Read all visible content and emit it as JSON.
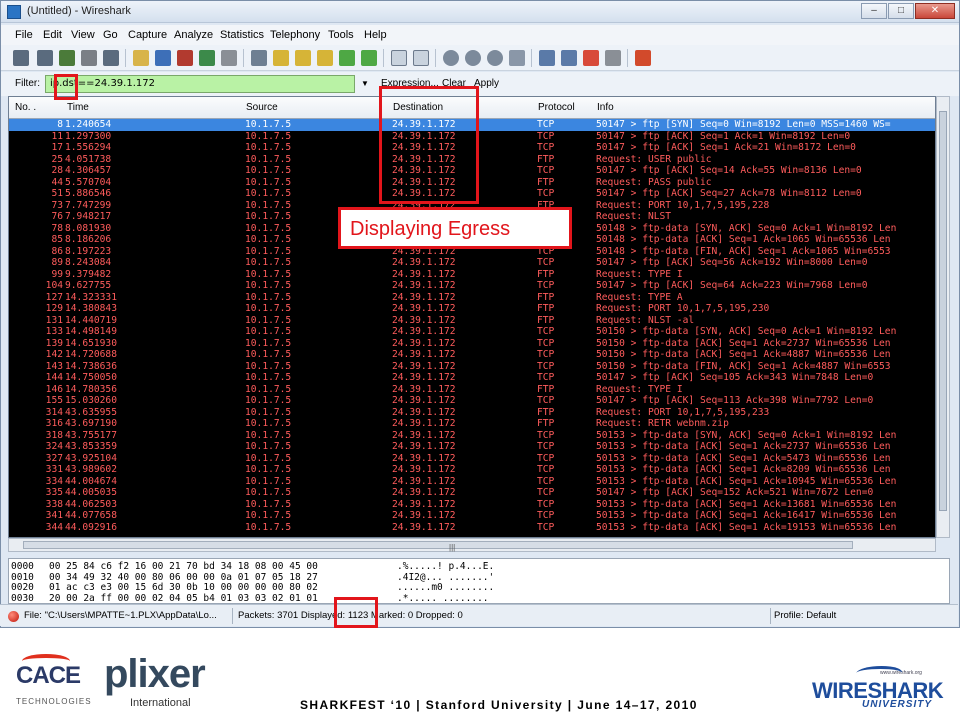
{
  "window": {
    "title": "(Untitled) - Wireshark",
    "controls": [
      "minimize",
      "maximize",
      "close"
    ]
  },
  "menu": [
    "File",
    "Edit",
    "View",
    "Go",
    "Capture",
    "Analyze",
    "Statistics",
    "Telephony",
    "Tools",
    "Help"
  ],
  "toolbar_icons": [
    "interface-list-icon",
    "capture-options-icon",
    "start-capture-icon",
    "stop-capture-icon",
    "restart-capture-icon",
    "open-file-icon",
    "save-file-icon",
    "close-file-icon",
    "reload-icon",
    "print-icon",
    "find-packet-icon",
    "go-back-icon",
    "go-forward-icon",
    "go-to-packet-icon",
    "go-first-icon",
    "go-last-icon",
    "colorize-icon",
    "autoscroll-icon",
    "zoom-in-icon",
    "zoom-out-icon",
    "normal-size-icon",
    "resize-columns-icon",
    "capture-filters-icon",
    "display-filters-icon",
    "coloring-rules-icon",
    "preferences-icon",
    "help-icon"
  ],
  "filter": {
    "label": "Filter:",
    "value": "ip.dst==24.39.1.172",
    "expression": "Expression...",
    "clear": "Clear",
    "apply": "Apply"
  },
  "packet_list": {
    "columns": [
      "No. .",
      "Time",
      "Source",
      "Destination",
      "Protocol",
      "Info"
    ],
    "rows": [
      {
        "no": "8",
        "time": "1.240654",
        "src": "10.1.7.5",
        "dst": "24.39.1.172",
        "proto": "TCP",
        "info": "50147 > ftp [SYN] Seq=0 Win=8192 Len=0 MSS=1460 WS=",
        "selected": true
      },
      {
        "no": "11",
        "time": "1.297300",
        "src": "10.1.7.5",
        "dst": "24.39.1.172",
        "proto": "TCP",
        "info": "50147 > ftp [ACK] Seq=1 Ack=1 Win=8192 Len=0"
      },
      {
        "no": "17",
        "time": "1.556294",
        "src": "10.1.7.5",
        "dst": "24.39.1.172",
        "proto": "TCP",
        "info": "50147 > ftp [ACK] Seq=1 Ack=21 Win=8172 Len=0"
      },
      {
        "no": "25",
        "time": "4.051738",
        "src": "10.1.7.5",
        "dst": "24.39.1.172",
        "proto": "FTP",
        "info": "Request: USER public"
      },
      {
        "no": "28",
        "time": "4.306457",
        "src": "10.1.7.5",
        "dst": "24.39.1.172",
        "proto": "TCP",
        "info": "50147 > ftp [ACK] Seq=14 Ack=55 Win=8136 Len=0"
      },
      {
        "no": "44",
        "time": "5.570704",
        "src": "10.1.7.5",
        "dst": "24.39.1.172",
        "proto": "FTP",
        "info": "Request: PASS public"
      },
      {
        "no": "51",
        "time": "5.886546",
        "src": "10.1.7.5",
        "dst": "24.39.1.172",
        "proto": "TCP",
        "info": "50147 > ftp [ACK] Seq=27 Ack=78 Win=8112 Len=0"
      },
      {
        "no": "73",
        "time": "7.747299",
        "src": "10.1.7.5",
        "dst": "24.39.1.172",
        "proto": "FTP",
        "info": "Request: PORT 10,1,7,5,195,228"
      },
      {
        "no": "76",
        "time": "7.948217",
        "src": "10.1.7.5",
        "dst": "24.39.1.172",
        "proto": "FTP",
        "info": "Request: NLST"
      },
      {
        "no": "78",
        "time": "8.081930",
        "src": "10.1.7.5",
        "dst": "24.39.1.172",
        "proto": "TCP",
        "info": "50148 > ftp-data [SYN, ACK] Seq=0 Ack=1 Win=8192 Len"
      },
      {
        "no": "85",
        "time": "8.186206",
        "src": "10.1.7.5",
        "dst": "24.39.1.172",
        "proto": "TCP",
        "info": "50148 > ftp-data [ACK] Seq=1 Ack=1065 Win=65536 Len"
      },
      {
        "no": "86",
        "time": "8.197223",
        "src": "10.1.7.5",
        "dst": "24.39.1.172",
        "proto": "TCP",
        "info": "50148 > ftp-data [FIN, ACK] Seq=1 Ack=1065 Win=6553"
      },
      {
        "no": "89",
        "time": "8.243084",
        "src": "10.1.7.5",
        "dst": "24.39.1.172",
        "proto": "TCP",
        "info": "50147 > ftp [ACK] Seq=56 Ack=192 Win=8000 Len=0"
      },
      {
        "no": "99",
        "time": "9.379482",
        "src": "10.1.7.5",
        "dst": "24.39.1.172",
        "proto": "FTP",
        "info": "Request: TYPE I"
      },
      {
        "no": "104",
        "time": "9.627755",
        "src": "10.1.7.5",
        "dst": "24.39.1.172",
        "proto": "TCP",
        "info": "50147 > ftp [ACK] Seq=64 Ack=223 Win=7968 Len=0"
      },
      {
        "no": "127",
        "time": "14.323331",
        "src": "10.1.7.5",
        "dst": "24.39.1.172",
        "proto": "FTP",
        "info": "Request: TYPE A"
      },
      {
        "no": "129",
        "time": "14.380843",
        "src": "10.1.7.5",
        "dst": "24.39.1.172",
        "proto": "FTP",
        "info": "Request: PORT 10,1,7,5,195,230"
      },
      {
        "no": "131",
        "time": "14.440719",
        "src": "10.1.7.5",
        "dst": "24.39.1.172",
        "proto": "FTP",
        "info": "Request: NLST -al"
      },
      {
        "no": "133",
        "time": "14.498149",
        "src": "10.1.7.5",
        "dst": "24.39.1.172",
        "proto": "TCP",
        "info": "50150 > ftp-data [SYN, ACK] Seq=0 Ack=1 Win=8192 Len"
      },
      {
        "no": "139",
        "time": "14.651930",
        "src": "10.1.7.5",
        "dst": "24.39.1.172",
        "proto": "TCP",
        "info": "50150 > ftp-data [ACK] Seq=1 Ack=2737 Win=65536 Len"
      },
      {
        "no": "142",
        "time": "14.720688",
        "src": "10.1.7.5",
        "dst": "24.39.1.172",
        "proto": "TCP",
        "info": "50150 > ftp-data [ACK] Seq=1 Ack=4887 Win=65536 Len"
      },
      {
        "no": "143",
        "time": "14.738636",
        "src": "10.1.7.5",
        "dst": "24.39.1.172",
        "proto": "TCP",
        "info": "50150 > ftp-data [FIN, ACK] Seq=1 Ack=4887 Win=6553"
      },
      {
        "no": "144",
        "time": "14.750050",
        "src": "10.1.7.5",
        "dst": "24.39.1.172",
        "proto": "TCP",
        "info": "50147 > ftp [ACK] Seq=105 Ack=343 Win=7848 Len=0"
      },
      {
        "no": "146",
        "time": "14.780356",
        "src": "10.1.7.5",
        "dst": "24.39.1.172",
        "proto": "FTP",
        "info": "Request: TYPE I"
      },
      {
        "no": "155",
        "time": "15.030260",
        "src": "10.1.7.5",
        "dst": "24.39.1.172",
        "proto": "TCP",
        "info": "50147 > ftp [ACK] Seq=113 Ack=398 Win=7792 Len=0"
      },
      {
        "no": "314",
        "time": "43.635955",
        "src": "10.1.7.5",
        "dst": "24.39.1.172",
        "proto": "FTP",
        "info": "Request: PORT 10,1,7,5,195,233"
      },
      {
        "no": "316",
        "time": "43.697190",
        "src": "10.1.7.5",
        "dst": "24.39.1.172",
        "proto": "FTP",
        "info": "Request: RETR webnm.zip"
      },
      {
        "no": "318",
        "time": "43.755177",
        "src": "10.1.7.5",
        "dst": "24.39.1.172",
        "proto": "TCP",
        "info": "50153 > ftp-data [SYN, ACK] Seq=0 Ack=1 Win=8192 Len"
      },
      {
        "no": "324",
        "time": "43.853359",
        "src": "10.1.7.5",
        "dst": "24.39.1.172",
        "proto": "TCP",
        "info": "50153 > ftp-data [ACK] Seq=1 Ack=2737 Win=65536 Len"
      },
      {
        "no": "327",
        "time": "43.925104",
        "src": "10.1.7.5",
        "dst": "24.39.1.172",
        "proto": "TCP",
        "info": "50153 > ftp-data [ACK] Seq=1 Ack=5473 Win=65536 Len"
      },
      {
        "no": "331",
        "time": "43.989602",
        "src": "10.1.7.5",
        "dst": "24.39.1.172",
        "proto": "TCP",
        "info": "50153 > ftp-data [ACK] Seq=1 Ack=8209 Win=65536 Len"
      },
      {
        "no": "334",
        "time": "44.004674",
        "src": "10.1.7.5",
        "dst": "24.39.1.172",
        "proto": "TCP",
        "info": "50153 > ftp-data [ACK] Seq=1 Ack=10945 Win=65536 Len"
      },
      {
        "no": "335",
        "time": "44.005035",
        "src": "10.1.7.5",
        "dst": "24.39.1.172",
        "proto": "TCP",
        "info": "50147 > ftp [ACK] Seq=152 Ack=521 Win=7672 Len=0"
      },
      {
        "no": "338",
        "time": "44.062503",
        "src": "10.1.7.5",
        "dst": "24.39.1.172",
        "proto": "TCP",
        "info": "50153 > ftp-data [ACK] Seq=1 Ack=13681 Win=65536 Len"
      },
      {
        "no": "341",
        "time": "44.077658",
        "src": "10.1.7.5",
        "dst": "24.39.1.172",
        "proto": "TCP",
        "info": "50153 > ftp-data [ACK] Seq=1 Ack=16417 Win=65536 Len"
      },
      {
        "no": "344",
        "time": "44.092916",
        "src": "10.1.7.5",
        "dst": "24.39.1.172",
        "proto": "TCP",
        "info": "50153 > ftp-data [ACK] Seq=1 Ack=19153 Win=65536 Len"
      }
    ]
  },
  "bytes_pane": {
    "rows": [
      {
        "offset": "0000",
        "hex": "00 25 84 c6 f2 16 00 21  70 bd 34 18 08 00 45 00",
        "ascii": ".%.....! p.4...E."
      },
      {
        "offset": "0010",
        "hex": "00 34 49 32 40 00 80 06  00 00 0a 01 07 05 18 27",
        "ascii": ".4I2@... .......'"
      },
      {
        "offset": "0020",
        "hex": "01 ac c3 e3 00 15 6d 30  0b 10 00 00 00 00 80 02",
        "ascii": "......m0 ........"
      },
      {
        "offset": "0030",
        "hex": "20 00 2a ff 00 00 02 04  05 b4 01 03 03 02 01 01",
        "ascii": " .*..... ........"
      }
    ]
  },
  "status": {
    "file": "File: \"C:\\Users\\MPATTE~1.PLX\\AppData\\Lo...",
    "packets": "Packets: 3701 Displayed: 1123 Marked: 0 Dropped: 0",
    "profile": "Profile: Default"
  },
  "annotation": {
    "callout": "Displaying Egress",
    "color": "#e2151b"
  },
  "footer": {
    "cace": "CACE",
    "cace_sub": "TECHNOLOGIES",
    "plixer": "plixer",
    "plixer_sub": "International",
    "event": "SHARKFEST ‘10  |  Stanford University  |  June 14–17, 2010",
    "wireshark_url": "www.wireshark.org",
    "wireshark": "WIRESHARK",
    "wireshark_sub": "UNIVERSITY"
  }
}
